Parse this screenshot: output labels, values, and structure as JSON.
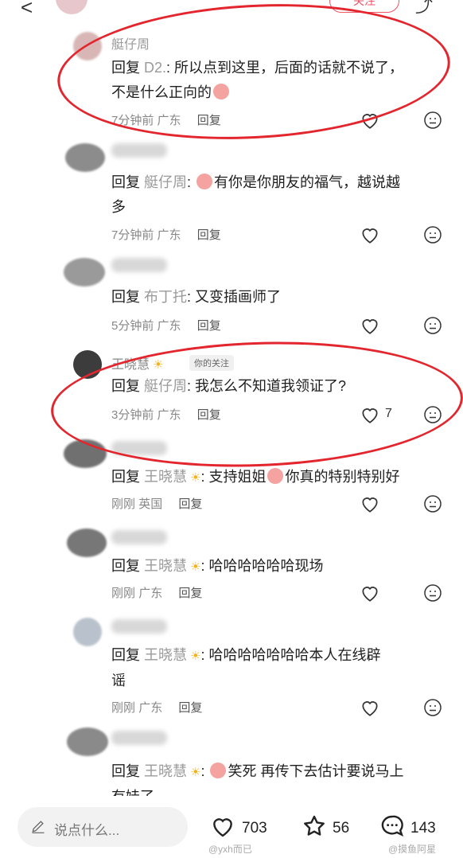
{
  "topbar": {
    "follow_label": "关注"
  },
  "comments": [
    {
      "name": "艇仔周",
      "reply_word": "回复",
      "target": "D2.",
      "text_1": ": 所以点到这里，后面的话就不说了，",
      "text_2": "不是什么正向的",
      "time": "7分钟前",
      "location": "广东",
      "reply_label": "回复"
    },
    {
      "reply_word": "回复",
      "target": "艇仔周",
      "text_1": ": ",
      "text_2": "有你是你朋友的福气，越说越",
      "text_3": "多",
      "time": "7分钟前",
      "location": "广东",
      "reply_label": "回复"
    },
    {
      "reply_word": "回复",
      "target": "布丁托",
      "text_1": ": 又变插画师了",
      "time": "5分钟前",
      "location": "广东",
      "reply_label": "回复"
    },
    {
      "name": "王晓慧",
      "follow_tag": "你的关注",
      "reply_word": "回复",
      "target": "艇仔周",
      "text_1": ": 我怎么不知道我领证了?",
      "time": "3分钟前",
      "location": "广东",
      "reply_label": "回复",
      "likes": "7"
    },
    {
      "reply_word": "回复",
      "target": "王晓慧",
      "text_1": ": 支持姐姐",
      "text_2": "你真的特别特别好",
      "time": "刚刚",
      "location": "英国",
      "reply_label": "回复"
    },
    {
      "reply_word": "回复",
      "target": "王晓慧",
      "text_1": ": 哈哈哈哈哈哈现场",
      "time": "刚刚",
      "location": "广东",
      "reply_label": "回复"
    },
    {
      "reply_word": "回复",
      "target": "王晓慧",
      "text_1": ": 哈哈哈哈哈哈哈本人在线辟",
      "text_2": "谣",
      "time": "刚刚",
      "location": "广东",
      "reply_label": "回复"
    },
    {
      "reply_word": "回复",
      "target": "王晓慧",
      "text_1": ": ",
      "text_2": "笑死 再传下去估计要说马上",
      "text_3": "有娃了"
    }
  ],
  "bottom": {
    "placeholder": "说点什么...",
    "likes": "703",
    "favorites": "56",
    "comments": "143"
  },
  "watermarks": {
    "left": "@yxh而已",
    "right": "@摸鱼阿星"
  },
  "colors": {
    "accent": "#e3262e",
    "secondary_text": "#9a9a9a"
  }
}
